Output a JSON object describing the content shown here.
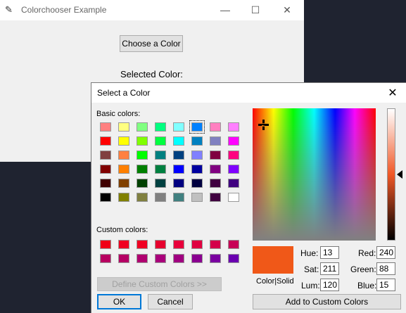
{
  "app": {
    "title": "Colorchooser Example",
    "choose_button": "Choose a Color",
    "selected_label": "Selected Color:",
    "window_controls": {
      "minimize": "—",
      "maximize": "☐",
      "close": "✕"
    }
  },
  "dialog": {
    "title": "Select a Color",
    "close": "✕",
    "basic_label": "Basic colors:",
    "custom_label": "Custom colors:",
    "basic_colors": [
      [
        "#ff8080",
        "#ffff80",
        "#80ff80",
        "#00ff80",
        "#80ffff",
        "#0080ff",
        "#ff80c0",
        "#ff80ff"
      ],
      [
        "#ff0000",
        "#ffff00",
        "#80ff00",
        "#00ff40",
        "#00ffff",
        "#0080c0",
        "#8080c0",
        "#ff00ff"
      ],
      [
        "#804040",
        "#ff8040",
        "#00ff00",
        "#008080",
        "#004080",
        "#8080ff",
        "#800040",
        "#ff0080"
      ],
      [
        "#800000",
        "#ff8000",
        "#008000",
        "#008040",
        "#0000ff",
        "#0000a0",
        "#800080",
        "#8000ff"
      ],
      [
        "#400000",
        "#804000",
        "#004000",
        "#004040",
        "#000080",
        "#000040",
        "#400040",
        "#400080"
      ],
      [
        "#000000",
        "#808000",
        "#808040",
        "#808080",
        "#408080",
        "#c0c0c0",
        "#400040",
        "#ffffff"
      ]
    ],
    "selected_swatch": "0-5",
    "custom_colors": [
      [
        "#f00016",
        "#f00021",
        "#f00023",
        "#e6002e",
        "#e8003b",
        "#e00040",
        "#d4004a",
        "#c70055"
      ],
      [
        "#b80060",
        "#b50064",
        "#b00070",
        "#a9007b",
        "#a00080",
        "#8a0090",
        "#7a00a0",
        "#6a00b0"
      ]
    ],
    "define_custom_button": "Define Custom Colors >>",
    "ok_button": "OK",
    "cancel_button": "Cancel",
    "add_custom_button": "Add to Custom Colors",
    "preview_color": "#f05818",
    "preview_label": "Color|Solid",
    "fields": {
      "hue_label": "Hue:",
      "hue": "13",
      "sat_label": "Sat:",
      "sat": "211",
      "lum_label": "Lum:",
      "lum": "120",
      "red_label": "Red:",
      "red": "240",
      "green_label": "Green:",
      "green": "88",
      "blue_label": "Blue:",
      "blue": "15"
    }
  }
}
